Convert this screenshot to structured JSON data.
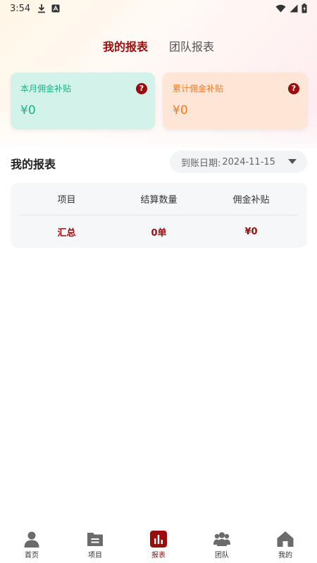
{
  "status_bar": {
    "time": "3:54"
  },
  "tabs": [
    {
      "label": "我的报表",
      "active": true
    },
    {
      "label": "团队报表",
      "active": false
    }
  ],
  "cards": {
    "monthly": {
      "title": "本月佣金补贴",
      "value": "¥0",
      "color": "#16b486"
    },
    "cumulative": {
      "title": "累计佣金补贴",
      "value": "¥0",
      "color": "#f07a22"
    },
    "help_glyph": "?"
  },
  "report": {
    "title": "我的报表",
    "date_label": "到账日期:",
    "date_value": "2024-11-15"
  },
  "table": {
    "headers": [
      "项目",
      "结算数量",
      "佣金补贴"
    ],
    "summary": [
      "汇总",
      "0单",
      "¥0"
    ]
  },
  "nav": [
    {
      "label": "首页",
      "icon": "person-icon"
    },
    {
      "label": "项目",
      "icon": "folder-icon"
    },
    {
      "label": "报表",
      "icon": "chart-icon",
      "active": true
    },
    {
      "label": "团队",
      "icon": "group-icon"
    },
    {
      "label": "我的",
      "icon": "home-icon"
    }
  ],
  "colors": {
    "accent": "#9b0d0d",
    "inactive_icon": "#6b6b6b"
  }
}
